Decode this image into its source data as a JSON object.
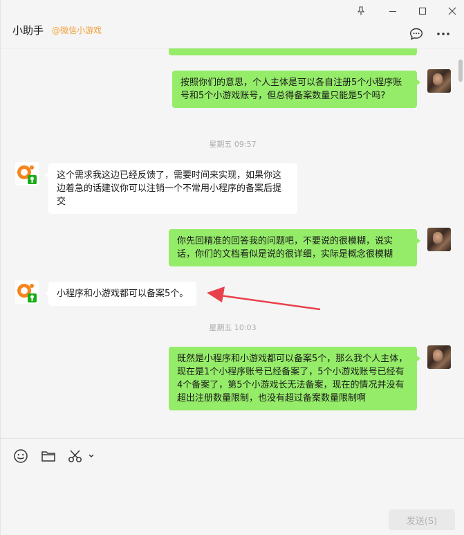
{
  "header": {
    "title": "小助手",
    "subtitle": "@微信小游戏"
  },
  "messages": [
    {
      "from": "me",
      "text": "按照你们的意思，个人主体是可以各自注册5个小程序账号和5个小游戏账号，但总得备案数量只能是5个吗?"
    },
    {
      "from": "time",
      "text": "星期五 09:57"
    },
    {
      "from": "other",
      "text": "这个需求我这边已经反馈了，需要时间来实现，如果你这边着急的话建议你可以注销一个不常用小程序的备案后提交"
    },
    {
      "from": "me",
      "text": "你先回精准的回答我的问题吧，不要说的很模糊，说实话，你们的文档看似是说的很详细，实际是概念很模糊"
    },
    {
      "from": "other",
      "text": "小程序和小游戏都可以备案5个。"
    },
    {
      "from": "time",
      "text": "星期五 10:03"
    },
    {
      "from": "me",
      "text": "既然是小程序和小游戏都可以备案5个，那么我个人主体，现在是1个小程序账号已经备案了，5个小游戏账号已经有4个备案了，第5个小游戏长无法备案，现在的情况并没有超出注册数量限制，也没有超过备案数量限制啊"
    }
  ],
  "input": {
    "send_label": "发送(S)"
  },
  "colors": {
    "my_bubble": "#95ec69",
    "other_bubble": "#ffffff",
    "accent": "#f2a13b",
    "annotation_arrow": "#e8414b"
  },
  "icons": {
    "pin": "pin-icon",
    "minimize": "minimize-icon",
    "maximize": "maximize-icon",
    "close": "close-icon",
    "chat_info": "chat-bubble-icon",
    "more": "more-icon",
    "emoji": "emoji-icon",
    "folder": "folder-icon",
    "scissors": "scissors-icon"
  }
}
